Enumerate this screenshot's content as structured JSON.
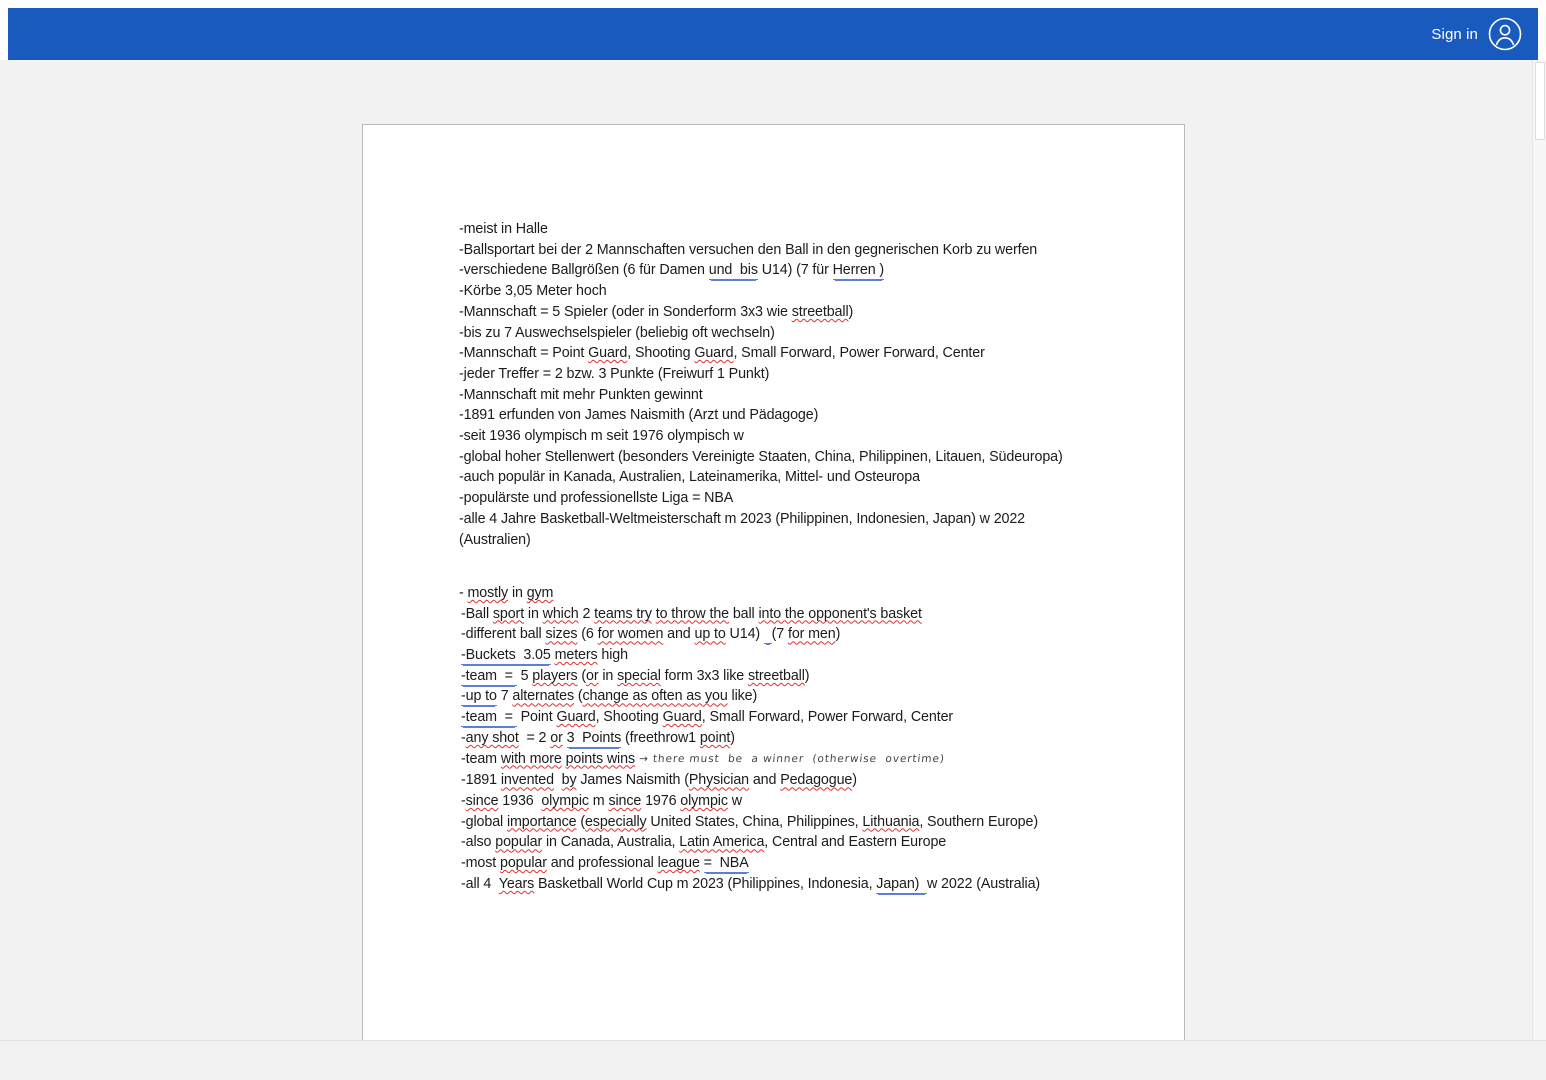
{
  "topbar": {
    "background_color": "#185ABD",
    "sign_in_label": "Sign in",
    "avatar_icon": "user-avatar-icon"
  },
  "scrollbar": {
    "orientation": "vertical",
    "thumb_visible": true
  },
  "document": {
    "title": "Basketball notes",
    "proofing": {
      "spelling_color": "#e03030",
      "grammar_color": "#5b7fd6",
      "ink_color": "#2a2a2a"
    },
    "german_section": {
      "lines": [
        "-meist in Halle",
        "-Ballsportart bei der 2 Mannschaften versuchen den Ball in den gegnerischen Korb zu werfen",
        "-verschiedene Ballgrößen (6 für Damen und  bis U14) (7 für Herren )",
        "-Körbe 3,05 Meter hoch",
        "-Mannschaft = 5 Spieler (oder in Sonderform 3x3 wie streetball)",
        "-bis zu 7 Auswechselspieler (beliebig oft wechseln)",
        "-Mannschaft = Point Guard, Shooting Guard, Small Forward, Power Forward, Center",
        "-jeder Treffer = 2 bzw. 3 Punkte (Freiwurf 1 Punkt)",
        "-Mannschaft mit mehr Punkten gewinnt",
        "-1891 erfunden von James Naismith (Arzt und Pädagoge)",
        "-seit 1936 olympisch m seit 1976 olympisch w",
        "-global hoher Stellenwert (besonders Vereinigte Staaten, China, Philippinen, Litauen, Südeuropa)",
        "-auch populär in Kanada, Australien, Lateinamerika, Mittel- und Osteuropa",
        "-populärste und professionellste Liga = NBA",
        "-alle 4 Jahre Basketball-Weltmeisterschaft m 2023 (Philippinen, Indonesien, Japan) w 2022",
        "(Australien)"
      ],
      "l1_a": "-meist in Halle",
      "l2_a": "-Ballsportart bei der 2 Mannschaften versuchen den Ball in den gegnerischen Korb zu werfen",
      "l3_a": "-verschiedene Ballgrößen (6 für Damen ",
      "l3_gr1": "und  bis",
      "l3_b": " U14) (7 für ",
      "l3_gr2": "Herren )",
      "l4_a": "-Körbe 3,05 Meter hoch",
      "l5_a": "-Mannschaft = 5 Spieler (oder in Sonderform 3x3 wie ",
      "l5_sp": "streetball",
      "l5_b": ")",
      "l6_a": "-bis zu 7 Auswechselspieler (beliebig oft wechseln)",
      "l7_a": "-Mannschaft = Point ",
      "l7_sp1": "Guard",
      "l7_b": ", Shooting ",
      "l7_sp2": "Guard",
      "l7_c": ", Small Forward, Power Forward, Center",
      "l8_a": "-jeder Treffer = 2 bzw. 3 Punkte (Freiwurf 1 Punkt)",
      "l9_a": "-Mannschaft mit mehr Punkten gewinnt",
      "l10_a": "-1891 erfunden von James Naismith (Arzt und Pädagoge)",
      "l11_a": "-seit 1936 olympisch m seit 1976 olympisch w",
      "l12_a": "-global hoher Stellenwert (besonders Vereinigte Staaten, China, Philippinen, Litauen, Südeuropa)",
      "l13_a": "-auch populär in Kanada, Australien, Lateinamerika, Mittel- und Osteuropa",
      "l14_a": "-populärste und professionellste Liga = NBA",
      "l15_a": "-alle 4 Jahre Basketball-Weltmeisterschaft m 2023 (Philippinen, Indonesien, Japan) w 2022",
      "l16_a": "(Australien)"
    },
    "english_section": {
      "lines": [
        "- mostly in gym",
        "-Ball sport in which 2 teams try to throw the ball into the opponent's basket",
        "-different ball sizes (6 for women and up to U14)  (7 for men)",
        "-Buckets  3.05 meters high",
        "-team  =  5 players (or in special form 3x3 like streetball)",
        "-up to 7 alternates (change as often as you like)",
        "-team  =  Point Guard, Shooting Guard, Small Forward, Power Forward, Center",
        "-any shot  = 2 or 3  Points (freethrow1 point)",
        "-team with more points wins → there must be a winner (otherwise overtime)",
        "-1891 invented  by James Naismith (Physician and Pedagogue)",
        "-since 1936  olympic m since 1976 olympic w",
        "-global importance (especially United States, China, Philippines, Lithuania, Southern Europe)",
        "-also popular in Canada, Australia, Latin America, Central and Eastern Europe",
        "-most popular and professional league =  NBA",
        "-all 4  Years Basketball World Cup m 2023 (Philippines, Indonesia, Japan)  w 2022 (Australia)"
      ],
      "e1_a": "- ",
      "e1_sp1": "mostly",
      "e1_b": " in ",
      "e1_sp2": "gym",
      "e2_a": "-Ball ",
      "e2_sp1": "sport",
      "e2_b": " in ",
      "e2_sp2": "which",
      "e2_c": " 2 ",
      "e2_sp3": "teams try",
      "e2_d": " ",
      "e2_sp4": "to throw the",
      "e2_e": " ball ",
      "e2_sp5": "into the opponent's basket",
      "e3_a": "-different ball ",
      "e3_sp1": "sizes",
      "e3_b": " (6 ",
      "e3_sp2": "for women",
      "e3_c": " and ",
      "e3_sp3": "up to",
      "e3_d": " U14) ",
      "e3_gr1": "  ",
      "e3_e": "(7 ",
      "e3_sp4": "for men",
      "e3_f": ")",
      "e4_gr1": "-Buckets  3.05",
      "e4_a": " ",
      "e4_sp1": "meters",
      "e4_b": " high",
      "e5_gr1": "-team  = ",
      "e5_a": " 5 ",
      "e5_sp1": "players",
      "e5_b": " (",
      "e5_sp2": "or",
      "e5_c": " in ",
      "e5_sp3": "special",
      "e5_d": " form 3x3 like ",
      "e5_sp4": "streetball",
      "e5_e": ")",
      "e6_gr1": "-up to",
      "e6_a": " 7 ",
      "e6_sp1": "alternates",
      "e6_b": " (",
      "e6_sp2": "change as often as you",
      "e6_c": " like)",
      "e7_gr1": "-team  = ",
      "e7_a": " Point ",
      "e7_sp1": "Guard",
      "e7_b": ", Shooting ",
      "e7_sp2": "Guard",
      "e7_c": ", Small Forward, Power Forward, Center",
      "e8_a": "-",
      "e8_sp1": "any shot",
      "e8_b": "  = 2 ",
      "e8_sp2": "or",
      "e8_c": " ",
      "e8_gr1": "3  Points",
      "e8_d": " (freethrow1 ",
      "e8_sp3": "point",
      "e8_e": ")",
      "e9_a": "-team ",
      "e9_sp1": "with more",
      "e9_b": " ",
      "e9_sp2": "points wins",
      "e9_ink": "→ there must  be  a winner  (otherwise  overtime)",
      "e10_a": "-1891 ",
      "e10_sp1": "invented",
      "e10_b": "  ",
      "e10_sp2": "by",
      "e10_c": " James Naismith (",
      "e10_sp3": "Physician",
      "e10_d": " and ",
      "e10_sp4": "Pedagogue",
      "e10_e": ")",
      "e11_a": "-",
      "e11_sp1": "since",
      "e11_b": " 1936  ",
      "e11_sp2": "olympic",
      "e11_c": " m ",
      "e11_sp3": "since",
      "e11_d": " 1976 ",
      "e11_sp4": "olympic",
      "e11_e": " w",
      "e12_a": "-global ",
      "e12_sp1": "importance",
      "e12_b": " (",
      "e12_sp2": "especially",
      "e12_c": " United States, China, Philippines, ",
      "e12_sp3": "Lithuania",
      "e12_d": ", Southern Europe)",
      "e13_a": "-also ",
      "e13_sp1": "popular",
      "e13_b": " in Canada, Australia, ",
      "e13_sp2": "Latin America",
      "e13_c": ", Central and Eastern Europe",
      "e14_a": "-most ",
      "e14_sp1": "popular",
      "e14_b": " and professional ",
      "e14_sp2": "league",
      "e14_c": " ",
      "e14_gr1": "=  NBA",
      "e15_a": "-all 4  ",
      "e15_sp1": "Years",
      "e15_b": " Basketball World Cup m 2023 (Philippines, Indonesia, ",
      "e15_gr1": "Japan)  ",
      "e15_c": "w 2022 (Australia)"
    }
  }
}
